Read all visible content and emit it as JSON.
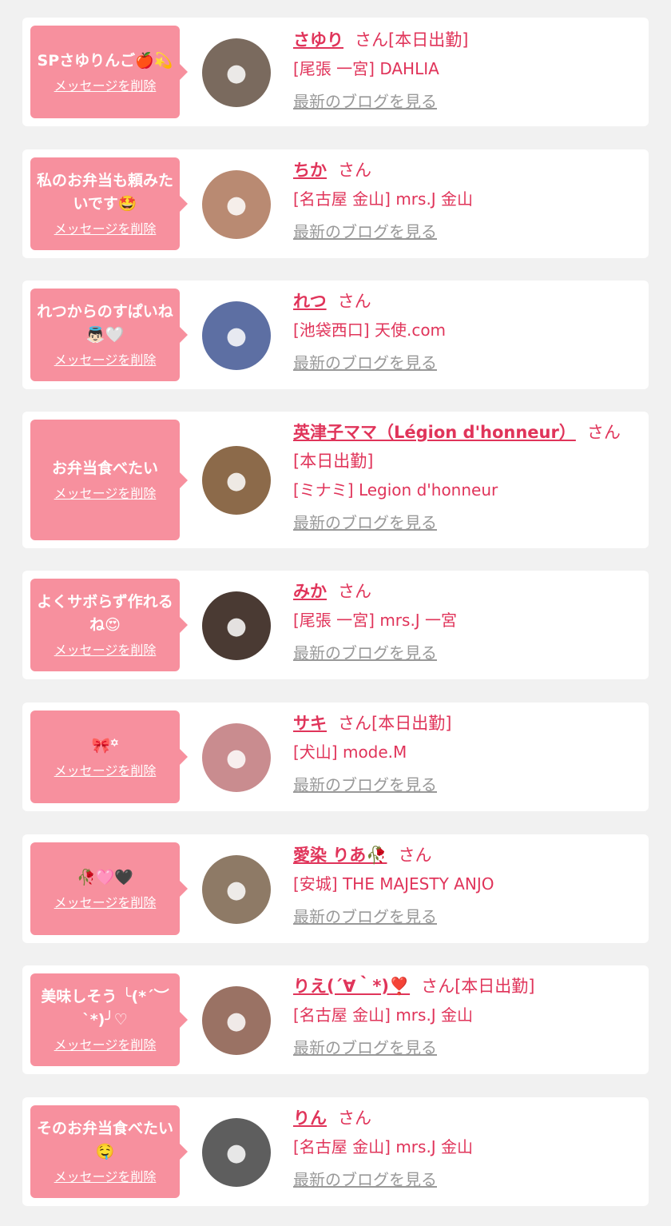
{
  "items": [
    {
      "message": "SPさゆりんご🍎💫",
      "delete_label": "メッセージを削除",
      "name": "さゆり",
      "suffix": "さん[本日出勤]",
      "shop": "[尾張 一宮] DAHLIA",
      "blog_label": "最新のブログを見る",
      "avatar_color": "#7a6a5e",
      "avatar_icon": "avatar-icon"
    },
    {
      "message": "私のお弁当も頼みたいです🤩",
      "delete_label": "メッセージを削除",
      "name": "ちか",
      "suffix": "さん",
      "shop": "[名古屋 金山] mrs.J 金山",
      "blog_label": "最新のブログを見る",
      "avatar_color": "#b98a72",
      "avatar_icon": "avatar-icon"
    },
    {
      "message": "れつからのすぱいね👼🏻🤍",
      "delete_label": "メッセージを削除",
      "name": "れつ",
      "suffix": "さん",
      "shop": "[池袋西口] 天使.com",
      "blog_label": "最新のブログを見る",
      "avatar_color": "#5d6fa3",
      "avatar_icon": "avatar-icon"
    },
    {
      "message": "お弁当食べたい",
      "delete_label": "メッセージを削除",
      "name": "英津子ママ（Légion d'honneur）",
      "suffix": "さん[本日出勤]",
      "shop": "[ミナミ] Legion d'honneur",
      "blog_label": "最新のブログを見る",
      "avatar_color": "#8c6a4a",
      "avatar_icon": "avatar-icon"
    },
    {
      "message": "よくサボらず作れるね😍",
      "delete_label": "メッセージを削除",
      "name": "みか",
      "suffix": "さん",
      "shop": "[尾張 一宮] mrs.J 一宮",
      "blog_label": "最新のブログを見る",
      "avatar_color": "#4a3a33",
      "avatar_icon": "avatar-icon"
    },
    {
      "message": "🎀꙳",
      "delete_label": "メッセージを削除",
      "name": "サキ",
      "suffix": "さん[本日出勤]",
      "shop": "[犬山] mode.M",
      "blog_label": "最新のブログを見る",
      "avatar_color": "#c98c8f",
      "avatar_icon": "avatar-icon"
    },
    {
      "message": "🥀🩷🖤",
      "delete_label": "メッセージを削除",
      "name": "愛染 りあ🥀",
      "suffix": "さん",
      "shop": "[安城] THE MAJESTY ANJO",
      "blog_label": "最新のブログを見る",
      "avatar_color": "#8e7a66",
      "avatar_icon": "avatar-icon"
    },
    {
      "message": "美味しそう ╰(*´︶`*)╯♡",
      "delete_label": "メッセージを削除",
      "name": "りえ(´∀｀*)❣️",
      "suffix": "さん[本日出勤]",
      "shop": "[名古屋 金山] mrs.J 金山",
      "blog_label": "最新のブログを見る",
      "avatar_color": "#9a7264",
      "avatar_icon": "avatar-icon"
    },
    {
      "message": "そのお弁当食べたい🤤",
      "delete_label": "メッセージを削除",
      "name": "りん",
      "suffix": "さん",
      "shop": "[名古屋 金山] mrs.J 金山",
      "blog_label": "最新のブログを見る",
      "avatar_color": "#5e5e5e",
      "avatar_icon": "avatar-icon"
    }
  ],
  "colors": {
    "bubble": "#f7909e",
    "accent": "#e0345a",
    "muted": "#999999",
    "background": "#f1f1f1"
  }
}
